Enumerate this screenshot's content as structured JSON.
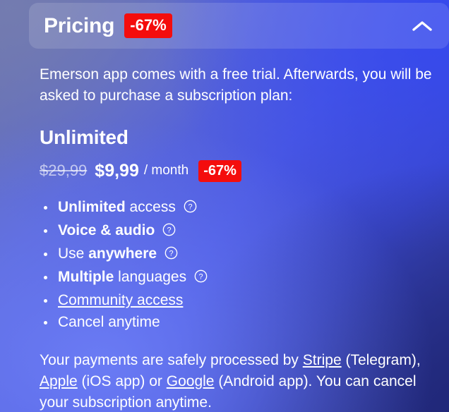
{
  "header": {
    "title": "Pricing",
    "badge": "-67%",
    "collapse_icon": "chevron-up-icon"
  },
  "intro": "Emerson app comes with a free trial. Afterwards, you will be asked to purchase a subscription plan:",
  "plan": {
    "name": "Unlimited",
    "old_price": "$29,99",
    "new_price": "$9,99",
    "period": "/ month",
    "badge": "-67%"
  },
  "features": [
    {
      "bold": "Unlimited",
      "rest": " access",
      "help": "help-icon",
      "link": false
    },
    {
      "bold": "Voice & audio",
      "rest": "",
      "help": "help-icon",
      "link": false
    },
    {
      "bold_after": true,
      "lead": "Use ",
      "bold": "anywhere",
      "rest": "",
      "help": "help-icon",
      "link": false
    },
    {
      "bold": "Multiple",
      "rest": " languages",
      "help": "help-icon",
      "link": false
    },
    {
      "bold": "",
      "rest": "Community access",
      "help": null,
      "link": true
    },
    {
      "bold": "",
      "rest": "Cancel anytime",
      "help": null,
      "link": false
    }
  ],
  "feature_labels": {
    "f0_bold": "Unlimited",
    "f0_rest": " access",
    "f1_bold": "Voice & audio",
    "f2_lead": "Use ",
    "f2_bold": "anywhere",
    "f3_bold": "Multiple",
    "f3_rest": " languages",
    "f4_link": "Community access",
    "f5_text": "Cancel anytime"
  },
  "footer": {
    "part1": "Your payments are safely processed by ",
    "link_stripe": "Stripe",
    "part2": " (Telegram), ",
    "link_apple": "Apple",
    "part3": " (iOS app) or ",
    "link_google": "Google",
    "part4": " (Android app). You can cancel your subscription anytime."
  },
  "colors": {
    "badge_red": "#f40d0d",
    "text_white": "#ffffff",
    "header_overlay": "rgba(255,255,255,0.13)"
  }
}
